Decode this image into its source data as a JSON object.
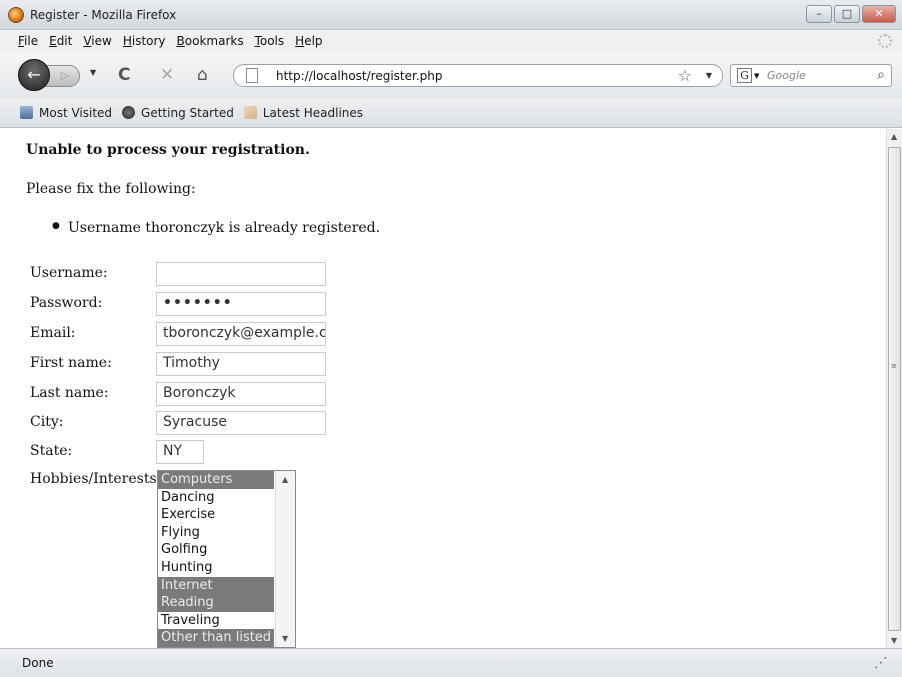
{
  "window": {
    "title": "Register - Mozilla Firefox",
    "buttons": [
      "–",
      "□",
      "✕"
    ]
  },
  "menu": [
    "File",
    "Edit",
    "View",
    "History",
    "Bookmarks",
    "Tools",
    "Help"
  ],
  "nav": {
    "back_icon": "back-arrow-icon",
    "url": "http://localhost/register.php",
    "search_placeholder": "Google",
    "search_engine_badge": "G"
  },
  "bookmarks": [
    {
      "label": "Most Visited",
      "icon": "most-visited-icon"
    },
    {
      "label": "Getting Started",
      "icon": "getting-started-icon"
    },
    {
      "label": "Latest Headlines",
      "icon": "rss-icon"
    }
  ],
  "page": {
    "error_title": "Unable to process your registration.",
    "fix_text": "Please fix the following:",
    "errors": [
      "Username thoronczyk is already registered."
    ],
    "form": {
      "username": {
        "label": "Username:",
        "value": ""
      },
      "password": {
        "label": "Password:",
        "value": "•••••••"
      },
      "email": {
        "label": "Email:",
        "value": "tboronczyk@example.com"
      },
      "first_name": {
        "label": "First name:",
        "value": "Timothy"
      },
      "last_name": {
        "label": "Last name:",
        "value": "Boronczyk"
      },
      "city": {
        "label": "City:",
        "value": "Syracuse"
      },
      "state": {
        "label": "State:",
        "value": "NY"
      },
      "hobbies": {
        "label": "Hobbies/Interests:",
        "options": [
          {
            "label": "Computers",
            "selected": true
          },
          {
            "label": "Dancing",
            "selected": false
          },
          {
            "label": "Exercise",
            "selected": false
          },
          {
            "label": "Flying",
            "selected": false
          },
          {
            "label": "Golfing",
            "selected": false
          },
          {
            "label": "Hunting",
            "selected": false
          },
          {
            "label": "Internet",
            "selected": true
          },
          {
            "label": "Reading",
            "selected": true
          },
          {
            "label": "Traveling",
            "selected": false
          },
          {
            "label": "Other than listed",
            "selected": true
          }
        ]
      }
    }
  },
  "status": {
    "text": "Done"
  }
}
